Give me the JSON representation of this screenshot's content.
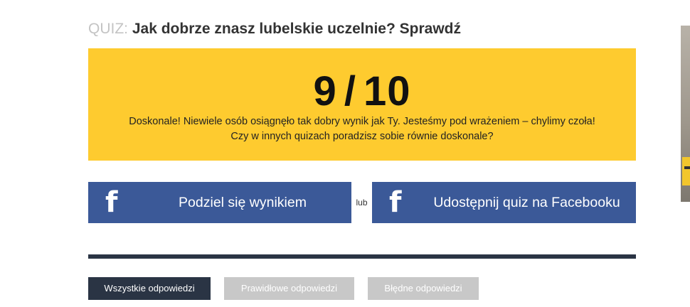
{
  "quiz": {
    "prefix": "QUIZ:",
    "title": "Jak dobrze znasz lubelskie uczelnie? Sprawdź"
  },
  "result": {
    "score": "9",
    "separator": "/",
    "total": "10",
    "message_line1": "Doskonale! Niewiele osób osiągnęło tak dobry wynik jak Ty. Jesteśmy pod wrażeniem – chylimy czoła!",
    "message_line2": "Czy w innych quizach poradzisz sobie równie doskonale?",
    "background_color": "#fecb2f"
  },
  "share": {
    "share_result_label": "Podziel się wynikiem",
    "or_label": "lub",
    "share_quiz_label": "Udostępnij quiz na Facebooku",
    "icon": "facebook-icon",
    "icon_glyph": "f",
    "button_color": "#3b5998"
  },
  "filters": {
    "tabs": [
      {
        "label": "Wszystkie odpowiedzi",
        "active": true
      },
      {
        "label": "Prawidłowe odpowiedzi",
        "active": false
      },
      {
        "label": "Błędne odpowiedzi",
        "active": false
      }
    ],
    "active_color": "#2a3444",
    "inactive_color": "#c8c8c8"
  }
}
